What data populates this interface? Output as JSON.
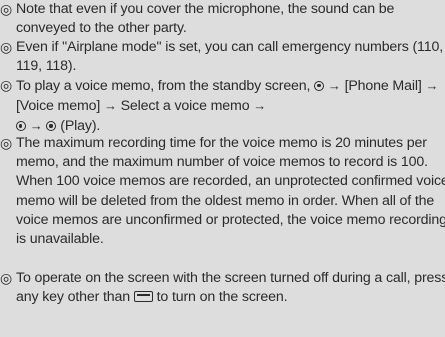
{
  "bullet_symbol": "◎",
  "notes": [
    {
      "text": "Note that even if you cover the microphone, the sound can be conveyed to the other party."
    },
    {
      "text": "Even if \"Airplane mode\" is set, you can call emergency numbers (110, 119, 118)."
    },
    {
      "part1": "To play a voice memo, from the standby screen,",
      "part2": "[Phone Mail]",
      "part3": "[Voice memo]",
      "part4": "Select a voice memo",
      "part5": "(Play).",
      "arrow": "→",
      "center_key_icon": "center-key-icon"
    },
    {
      "text": "The maximum recording time for the voice memo is 20 minutes per memo, and the maximum number of voice memos to record is 100. When 100 voice memos are recorded, an unprotected confirmed voice memo will be deleted from the oldest memo in order. When all of the voice memos are unconfirmed or protected, the voice memo recording is unavailable."
    },
    {
      "part1": "To operate on the screen with the screen turned off during a call, press any key other than",
      "part2": "to turn on the screen.",
      "key_icon": "end-key-icon"
    }
  ],
  "colors": {
    "background": "#dddddd",
    "text": "#2b2b2b"
  }
}
